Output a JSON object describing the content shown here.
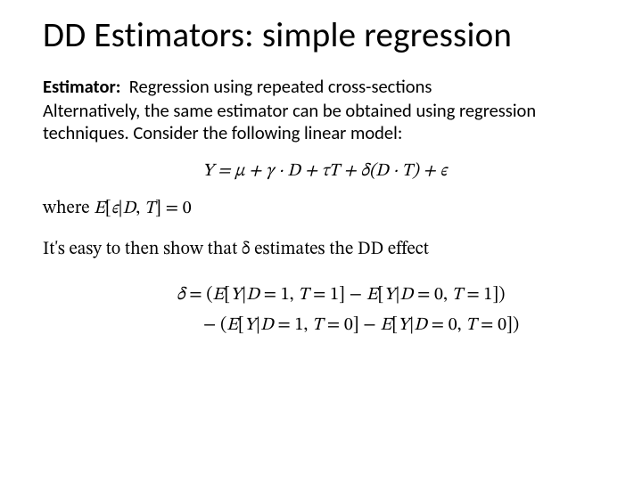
{
  "title": "DD Estimators: simple regression",
  "estimator_label": "Estimator:",
  "estimator_text": "Regression using repeated cross-sections",
  "intro_text": "Alternatively, the same estimator can be obtained using regression techniques.  Consider the following linear model:",
  "eq_main": "Y = μ + γ · D + τT + δ(D · T) + ϵ",
  "where_text": "where E[ϵ|D, T] = 0",
  "easy_text": "It's easy to then show that δ estimates the DD effect",
  "delta_line1": "δ = (E[Y|D = 1, T = 1] − E[Y|D = 0, T = 1])",
  "delta_line2": "− (E[Y|D = 1, T = 0] − E[Y|D = 0, T = 0])"
}
